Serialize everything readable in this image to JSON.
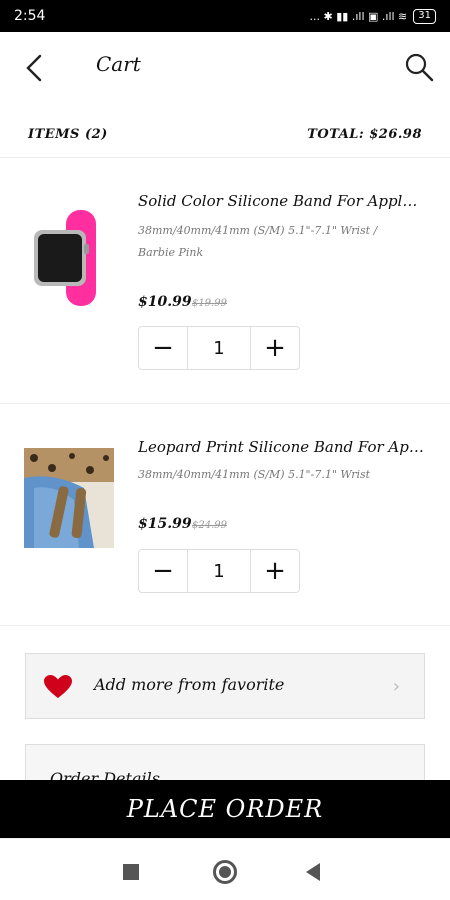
{
  "status_bar": {
    "time": "2:54",
    "icons": "... ✱ ▮▮ .ıll ▣ .ıll ≋",
    "battery": "31"
  },
  "header": {
    "title": "Cart"
  },
  "summary": {
    "items_label": "ITEMS (2)",
    "total_label": "TOTAL: $26.98"
  },
  "items": [
    {
      "title": "Solid Color Silicone Band For Apple...",
      "variant_line1": "38mm/40mm/41mm (S/M) 5.1\"-7.1\" Wrist /",
      "variant_line2": "Barbie Pink",
      "price": "$10.99",
      "old_price": "$19.99",
      "quantity": "1"
    },
    {
      "title": "Leopard Print Silicone Band For Appl...",
      "variant_line1": "38mm/40mm/41mm (S/M) 5.1\"-7.1\" Wrist",
      "variant_line2": "",
      "price": "$15.99",
      "old_price": "$24.99",
      "quantity": "1"
    }
  ],
  "stepper": {
    "minus": "−",
    "plus": "+"
  },
  "favorite": {
    "label": "Add more from favorite",
    "chevron": "›"
  },
  "order_details": {
    "title": "Order Details"
  },
  "place_order": {
    "label": "PLACE ORDER"
  },
  "colors": {
    "heart": "#d0021b",
    "band_pink": "#ff2fa0"
  }
}
